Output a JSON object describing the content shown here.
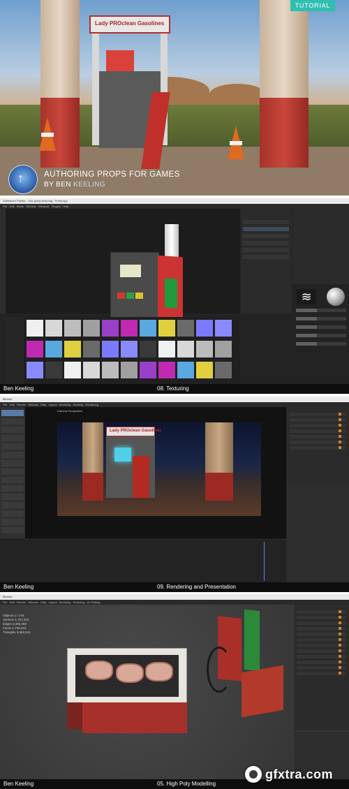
{
  "hero": {
    "badge": "TUTORIAL",
    "title": "AUTHORING PROPS FOR GAMES",
    "byline_prefix": "BY BEN ",
    "byline_name": "KEELING",
    "pump_sign": "Lady PROclean Gasolines"
  },
  "texturing_panel": {
    "window_title": "Substance Painter - Gas pump texturing - Pump.spp",
    "caption_author": "Ben Keeling",
    "caption_section": "08. Texturing"
  },
  "rendering_panel": {
    "window_title": "Blender",
    "caption_author": "Ben Keeling",
    "caption_section": "09. Rendering and Presentation",
    "pump_sign": "Lady PROclean Gasolines",
    "viewport_label": "Camera Perspective"
  },
  "highpoly_panel": {
    "window_title": "Blender",
    "caption_author": "Ben Keeling",
    "caption_section": "05. High Poly Modelling",
    "stats": [
      "Objects 1 / 176",
      "Vertices 1,757,210",
      "Edges 3,493,492",
      "Faces 1,736,222",
      "Triangles 3,462,524"
    ]
  },
  "watermark": {
    "text": "gfxtra.com"
  },
  "colors": {
    "accent_teal": "#2fbfb0",
    "blender_orange": "#d48a2a",
    "pump_red": "#c0302a"
  }
}
